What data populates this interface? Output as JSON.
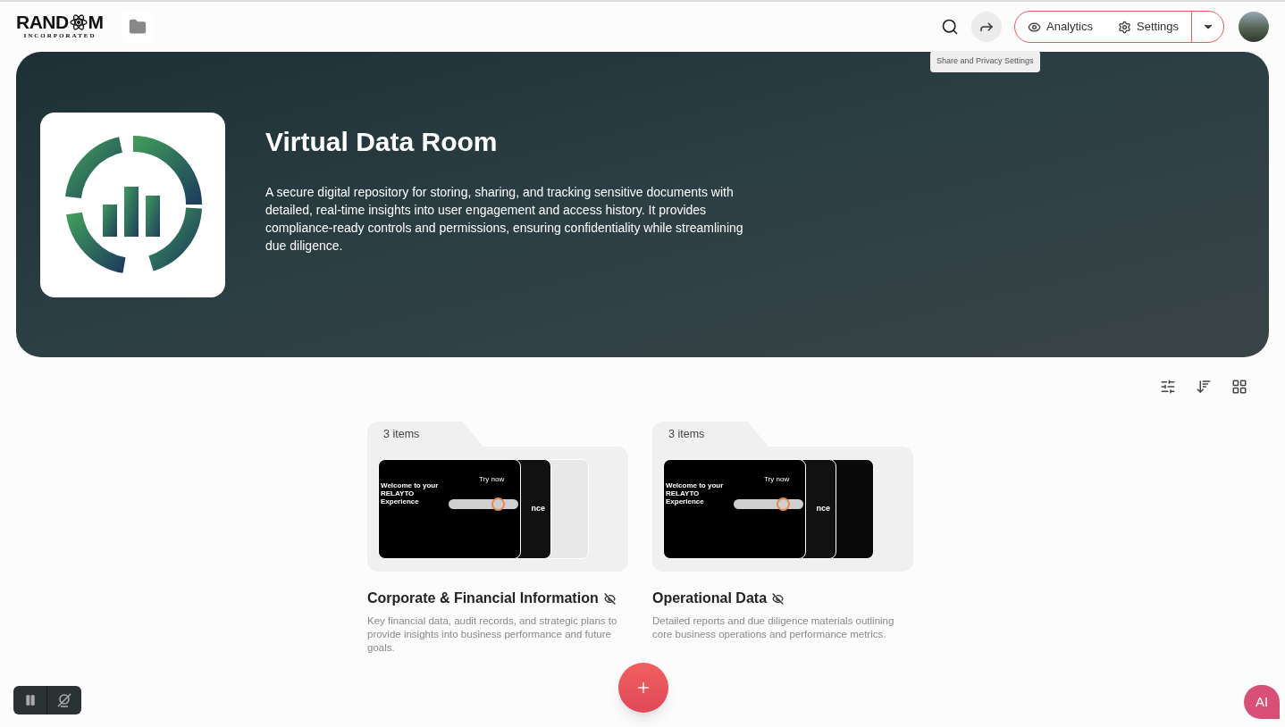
{
  "header": {
    "logo": {
      "word_start": "RAND",
      "word_end": "M",
      "subtitle": "INCORPORATED"
    },
    "actions": [
      {
        "label": "Analytics",
        "kind": "eye"
      },
      {
        "label": "Settings",
        "kind": "gear"
      }
    ],
    "tooltip": "Share and Privacy Settings"
  },
  "hero": {
    "title": "Virtual Data Room",
    "description": "A secure digital repository for storing, sharing, and tracking sensitive documents with detailed, real-time insights into user engagement and access history. It provides compliance-ready controls and permissions, ensuring confidentiality while streamlining due diligence."
  },
  "folders": [
    {
      "count": "3 items",
      "title": "Corporate & Financial Information",
      "hidden": true,
      "description": "Key financial data, audit records, and strategic plans to provide insights into business performance and future goals.",
      "slide_title": "Welcome to your RELAYTO Experience",
      "slide_button": "Try now",
      "middle_text": "nce",
      "kind": "light"
    },
    {
      "count": "3 items",
      "title": "Operational Data",
      "hidden": true,
      "description": "Detailed reports and due diligence materials outlining core business operations and performance metrics.",
      "slide_title": "Welcome to your RELAYTO Experience",
      "slide_button": "Try now",
      "middle_text": "nce",
      "kind": "dark"
    }
  ],
  "assistant": {
    "label": "AI"
  }
}
